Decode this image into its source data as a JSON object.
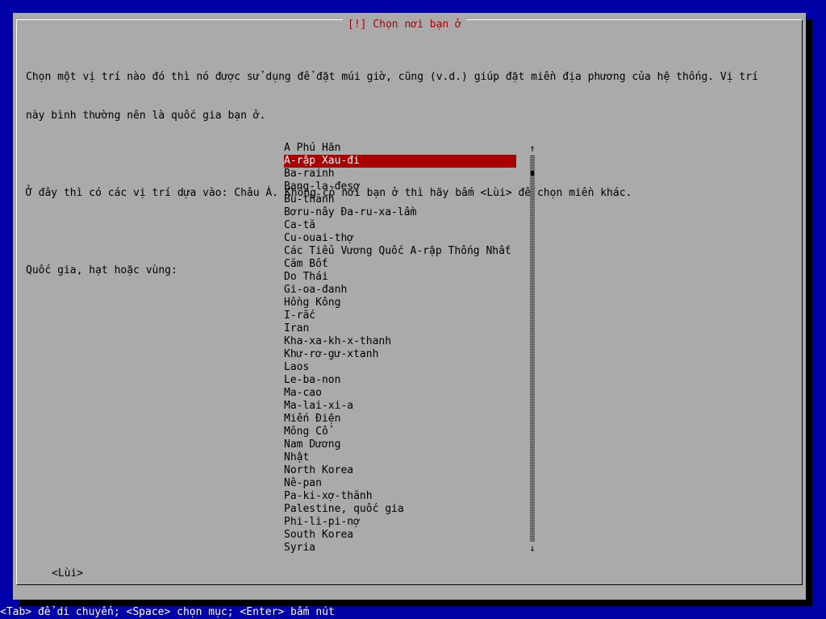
{
  "dialog": {
    "title": "[!] Chọn nơi bạn ở",
    "description_line1": "Chọn một vị trí nào đó thì nó được sử dụng để đặt múi giờ, cũng (v.d.) giúp đặt miền địa phương của hệ thống. Vị trí",
    "description_line2": "này bình thường nên là quốc gia bạn ở.",
    "info_line": "Ở đây thì có các vị trí dựa vào: Châu Á. Không có nơi bạn ở thì hãy bấm <Lùi> để chọn miền khác.",
    "list_label": "Quốc gia, hạt hoặc vùng:"
  },
  "countries": [
    "A Phú Hãn",
    "A-rập Xau-đi",
    "Ba-rainh",
    "Bang-la-đesợ",
    "Bu-thănh",
    "Bơru-nây Đa-ru-xa-lầm",
    "Ca-tă",
    "Cu-ouai-thợ",
    "Các Tiểu Vương Quốc A-rập Thống Nhất",
    "Căm Bốt",
    "Do Thái",
    "Gi-oa-đanh",
    "Hồng Kông",
    "I-rắc",
    "Iran",
    "Kha-xa-kh-x-thanh",
    "Khư-rơ-gư-xtanh",
    "Laos",
    "Le-ba-non",
    "Ma-cao",
    "Ma-lai-xi-a",
    "Miến Điện",
    "Mông Cổ",
    "Nam Dương",
    "Nhật",
    "North Korea",
    "Nê-pan",
    "Pa-ki-xợ-thănh",
    "Palestine, quốc gia",
    "Phi-li-pi-nợ",
    "South Korea",
    "Syria"
  ],
  "selected_index": 1,
  "scrollbar": {
    "up_arrow": "↑",
    "down_arrow": "↓"
  },
  "buttons": {
    "back": "<Lùi>"
  },
  "footer": {
    "help": "<Tab> để di chuyển; <Space> chọn mục; <Enter> bấm nút"
  },
  "colors": {
    "background": "#0000a8",
    "dialog": "#aaaaaa",
    "highlight": "#a80000",
    "title_text": "#a80000"
  }
}
